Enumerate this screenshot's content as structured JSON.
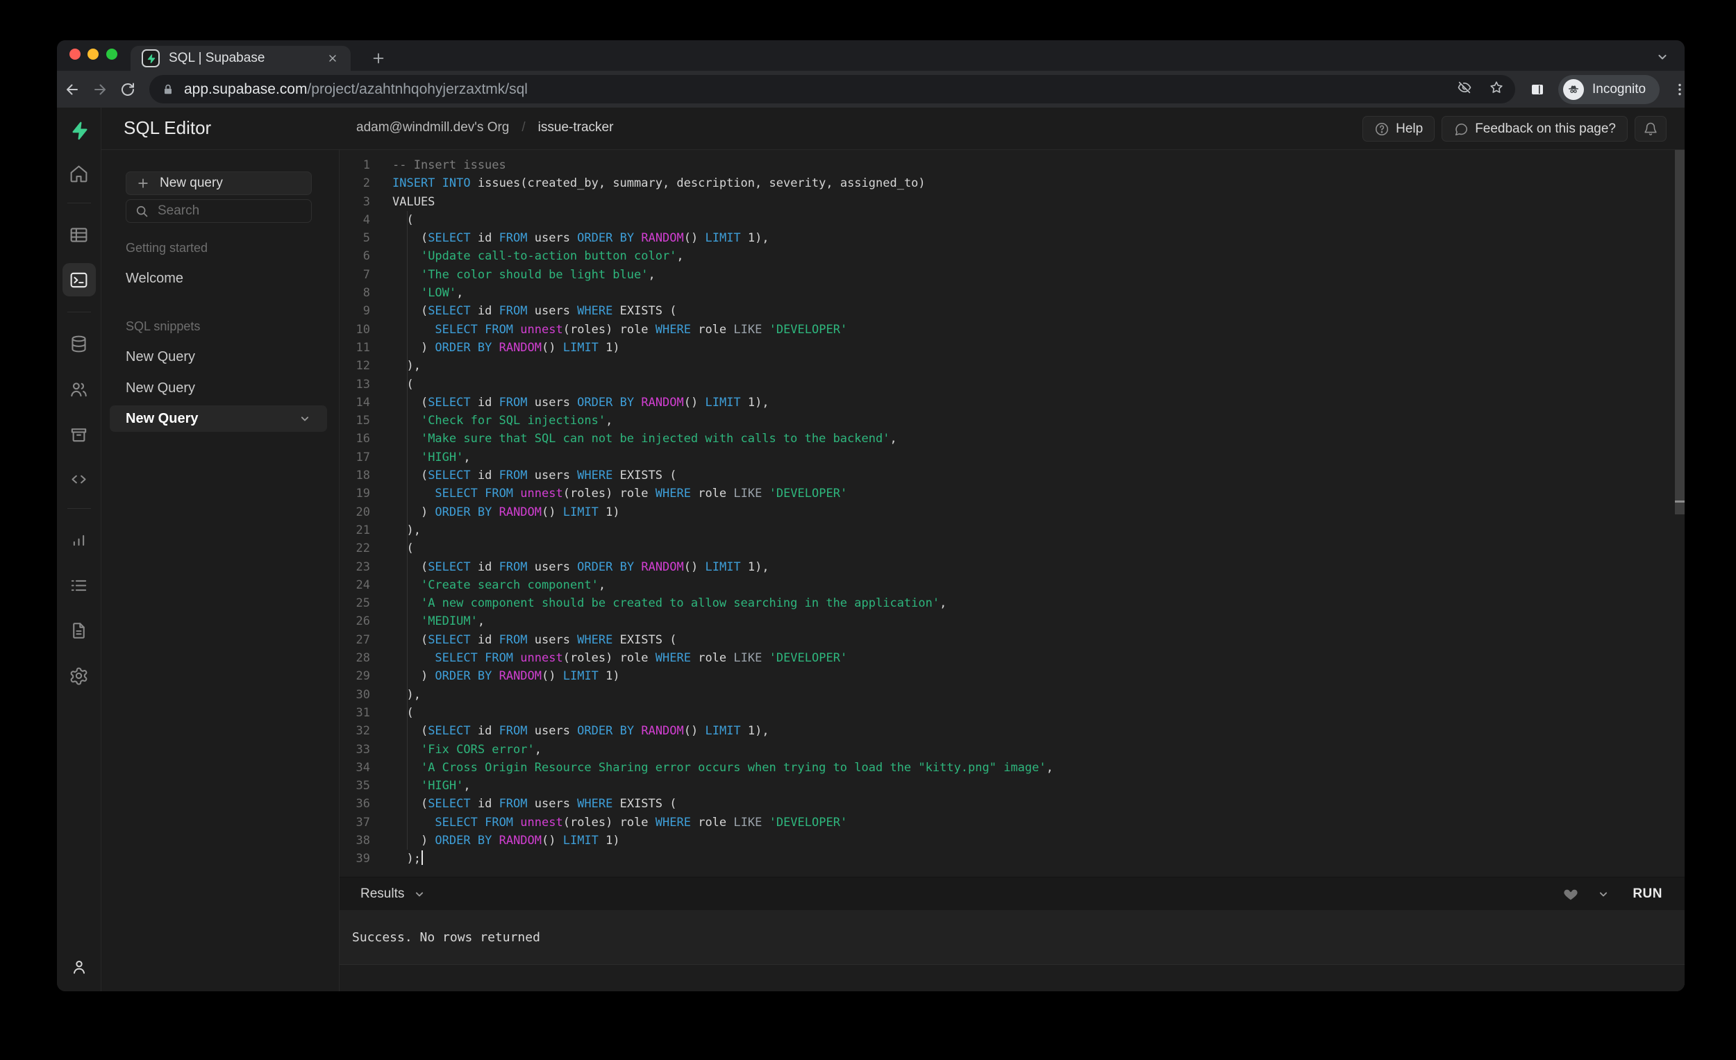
{
  "browser": {
    "tab_title": "SQL | Supabase",
    "url_host": "app.supabase.com",
    "url_path": "/project/azahtnhqohyjerzaxtmk/sql",
    "incognito_label": "Incognito"
  },
  "header": {
    "title": "SQL Editor",
    "breadcrumb": {
      "org": "adam@windmill.dev's Org",
      "separator": "/",
      "project": "issue-tracker"
    },
    "help_label": "Help",
    "feedback_label": "Feedback on this page?"
  },
  "rail": {
    "items": [
      {
        "name": "home"
      },
      {
        "name": "divider"
      },
      {
        "name": "table-editor"
      },
      {
        "name": "sql-editor",
        "active": true
      },
      {
        "name": "divider"
      },
      {
        "name": "database"
      },
      {
        "name": "auth"
      },
      {
        "name": "storage"
      },
      {
        "name": "edge-functions"
      },
      {
        "name": "divider"
      },
      {
        "name": "reports"
      },
      {
        "name": "logs"
      },
      {
        "name": "docs"
      },
      {
        "name": "settings"
      }
    ]
  },
  "sidebar": {
    "new_query_label": "New query",
    "search_placeholder": "Search",
    "sections": [
      {
        "label": "Getting started",
        "items": [
          {
            "label": "Welcome"
          }
        ]
      },
      {
        "label": "SQL snippets",
        "items": [
          {
            "label": "New Query"
          },
          {
            "label": "New Query"
          },
          {
            "label": "New Query",
            "active": true
          }
        ]
      }
    ]
  },
  "editor": {
    "cursor_line": 39,
    "lines": [
      [
        [
          "c",
          "-- Insert issues"
        ]
      ],
      [
        [
          "k",
          "INSERT"
        ],
        [
          "p",
          " "
        ],
        [
          "k",
          "INTO"
        ],
        [
          "p",
          " issues(created_by, summary, description, severity, assigned_to)"
        ]
      ],
      [
        [
          "p",
          "VALUES"
        ]
      ],
      [
        [
          "p",
          "  ("
        ]
      ],
      [
        [
          "p",
          "    ("
        ],
        [
          "k",
          "SELECT"
        ],
        [
          "p",
          " id "
        ],
        [
          "k",
          "FROM"
        ],
        [
          "p",
          " users "
        ],
        [
          "k",
          "ORDER"
        ],
        [
          "p",
          " "
        ],
        [
          "k",
          "BY"
        ],
        [
          "p",
          " "
        ],
        [
          "f",
          "RANDOM"
        ],
        [
          "p",
          "() "
        ],
        [
          "k",
          "LIMIT"
        ],
        [
          "p",
          " 1),"
        ]
      ],
      [
        [
          "p",
          "    "
        ],
        [
          "s",
          "'Update call-to-action button color'"
        ],
        [
          "p",
          ","
        ]
      ],
      [
        [
          "p",
          "    "
        ],
        [
          "s",
          "'The color should be light blue'"
        ],
        [
          "p",
          ","
        ]
      ],
      [
        [
          "p",
          "    "
        ],
        [
          "s",
          "'LOW'"
        ],
        [
          "p",
          ","
        ]
      ],
      [
        [
          "p",
          "    ("
        ],
        [
          "k",
          "SELECT"
        ],
        [
          "p",
          " id "
        ],
        [
          "k",
          "FROM"
        ],
        [
          "p",
          " users "
        ],
        [
          "k",
          "WHERE"
        ],
        [
          "p",
          " EXISTS ("
        ]
      ],
      [
        [
          "p",
          "      "
        ],
        [
          "k",
          "SELECT"
        ],
        [
          "p",
          " "
        ],
        [
          "k",
          "FROM"
        ],
        [
          "p",
          " "
        ],
        [
          "f",
          "unnest"
        ],
        [
          "p",
          "(roles) role "
        ],
        [
          "k",
          "WHERE"
        ],
        [
          "p",
          " role "
        ],
        [
          "o",
          "LIKE"
        ],
        [
          "p",
          " "
        ],
        [
          "s",
          "'DEVELOPER'"
        ]
      ],
      [
        [
          "p",
          "    ) "
        ],
        [
          "k",
          "ORDER"
        ],
        [
          "p",
          " "
        ],
        [
          "k",
          "BY"
        ],
        [
          "p",
          " "
        ],
        [
          "f",
          "RANDOM"
        ],
        [
          "p",
          "() "
        ],
        [
          "k",
          "LIMIT"
        ],
        [
          "p",
          " 1)"
        ]
      ],
      [
        [
          "p",
          "  ),"
        ]
      ],
      [
        [
          "p",
          "  ("
        ]
      ],
      [
        [
          "p",
          "    ("
        ],
        [
          "k",
          "SELECT"
        ],
        [
          "p",
          " id "
        ],
        [
          "k",
          "FROM"
        ],
        [
          "p",
          " users "
        ],
        [
          "k",
          "ORDER"
        ],
        [
          "p",
          " "
        ],
        [
          "k",
          "BY"
        ],
        [
          "p",
          " "
        ],
        [
          "f",
          "RANDOM"
        ],
        [
          "p",
          "() "
        ],
        [
          "k",
          "LIMIT"
        ],
        [
          "p",
          " 1),"
        ]
      ],
      [
        [
          "p",
          "    "
        ],
        [
          "s",
          "'Check for SQL injections'"
        ],
        [
          "p",
          ","
        ]
      ],
      [
        [
          "p",
          "    "
        ],
        [
          "s",
          "'Make sure that SQL can not be injected with calls to the backend'"
        ],
        [
          "p",
          ","
        ]
      ],
      [
        [
          "p",
          "    "
        ],
        [
          "s",
          "'HIGH'"
        ],
        [
          "p",
          ","
        ]
      ],
      [
        [
          "p",
          "    ("
        ],
        [
          "k",
          "SELECT"
        ],
        [
          "p",
          " id "
        ],
        [
          "k",
          "FROM"
        ],
        [
          "p",
          " users "
        ],
        [
          "k",
          "WHERE"
        ],
        [
          "p",
          " EXISTS ("
        ]
      ],
      [
        [
          "p",
          "      "
        ],
        [
          "k",
          "SELECT"
        ],
        [
          "p",
          " "
        ],
        [
          "k",
          "FROM"
        ],
        [
          "p",
          " "
        ],
        [
          "f",
          "unnest"
        ],
        [
          "p",
          "(roles) role "
        ],
        [
          "k",
          "WHERE"
        ],
        [
          "p",
          " role "
        ],
        [
          "o",
          "LIKE"
        ],
        [
          "p",
          " "
        ],
        [
          "s",
          "'DEVELOPER'"
        ]
      ],
      [
        [
          "p",
          "    ) "
        ],
        [
          "k",
          "ORDER"
        ],
        [
          "p",
          " "
        ],
        [
          "k",
          "BY"
        ],
        [
          "p",
          " "
        ],
        [
          "f",
          "RANDOM"
        ],
        [
          "p",
          "() "
        ],
        [
          "k",
          "LIMIT"
        ],
        [
          "p",
          " 1)"
        ]
      ],
      [
        [
          "p",
          "  ),"
        ]
      ],
      [
        [
          "p",
          "  ("
        ]
      ],
      [
        [
          "p",
          "    ("
        ],
        [
          "k",
          "SELECT"
        ],
        [
          "p",
          " id "
        ],
        [
          "k",
          "FROM"
        ],
        [
          "p",
          " users "
        ],
        [
          "k",
          "ORDER"
        ],
        [
          "p",
          " "
        ],
        [
          "k",
          "BY"
        ],
        [
          "p",
          " "
        ],
        [
          "f",
          "RANDOM"
        ],
        [
          "p",
          "() "
        ],
        [
          "k",
          "LIMIT"
        ],
        [
          "p",
          " 1),"
        ]
      ],
      [
        [
          "p",
          "    "
        ],
        [
          "s",
          "'Create search component'"
        ],
        [
          "p",
          ","
        ]
      ],
      [
        [
          "p",
          "    "
        ],
        [
          "s",
          "'A new component should be created to allow searching in the application'"
        ],
        [
          "p",
          ","
        ]
      ],
      [
        [
          "p",
          "    "
        ],
        [
          "s",
          "'MEDIUM'"
        ],
        [
          "p",
          ","
        ]
      ],
      [
        [
          "p",
          "    ("
        ],
        [
          "k",
          "SELECT"
        ],
        [
          "p",
          " id "
        ],
        [
          "k",
          "FROM"
        ],
        [
          "p",
          " users "
        ],
        [
          "k",
          "WHERE"
        ],
        [
          "p",
          " EXISTS ("
        ]
      ],
      [
        [
          "p",
          "      "
        ],
        [
          "k",
          "SELECT"
        ],
        [
          "p",
          " "
        ],
        [
          "k",
          "FROM"
        ],
        [
          "p",
          " "
        ],
        [
          "f",
          "unnest"
        ],
        [
          "p",
          "(roles) role "
        ],
        [
          "k",
          "WHERE"
        ],
        [
          "p",
          " role "
        ],
        [
          "o",
          "LIKE"
        ],
        [
          "p",
          " "
        ],
        [
          "s",
          "'DEVELOPER'"
        ]
      ],
      [
        [
          "p",
          "    ) "
        ],
        [
          "k",
          "ORDER"
        ],
        [
          "p",
          " "
        ],
        [
          "k",
          "BY"
        ],
        [
          "p",
          " "
        ],
        [
          "f",
          "RANDOM"
        ],
        [
          "p",
          "() "
        ],
        [
          "k",
          "LIMIT"
        ],
        [
          "p",
          " 1)"
        ]
      ],
      [
        [
          "p",
          "  ),"
        ]
      ],
      [
        [
          "p",
          "  ("
        ]
      ],
      [
        [
          "p",
          "    ("
        ],
        [
          "k",
          "SELECT"
        ],
        [
          "p",
          " id "
        ],
        [
          "k",
          "FROM"
        ],
        [
          "p",
          " users "
        ],
        [
          "k",
          "ORDER"
        ],
        [
          "p",
          " "
        ],
        [
          "k",
          "BY"
        ],
        [
          "p",
          " "
        ],
        [
          "f",
          "RANDOM"
        ],
        [
          "p",
          "() "
        ],
        [
          "k",
          "LIMIT"
        ],
        [
          "p",
          " 1),"
        ]
      ],
      [
        [
          "p",
          "    "
        ],
        [
          "s",
          "'Fix CORS error'"
        ],
        [
          "p",
          ","
        ]
      ],
      [
        [
          "p",
          "    "
        ],
        [
          "s",
          "'A Cross Origin Resource Sharing error occurs when trying to load the \"kitty.png\" image'"
        ],
        [
          "p",
          ","
        ]
      ],
      [
        [
          "p",
          "    "
        ],
        [
          "s",
          "'HIGH'"
        ],
        [
          "p",
          ","
        ]
      ],
      [
        [
          "p",
          "    ("
        ],
        [
          "k",
          "SELECT"
        ],
        [
          "p",
          " id "
        ],
        [
          "k",
          "FROM"
        ],
        [
          "p",
          " users "
        ],
        [
          "k",
          "WHERE"
        ],
        [
          "p",
          " EXISTS ("
        ]
      ],
      [
        [
          "p",
          "      "
        ],
        [
          "k",
          "SELECT"
        ],
        [
          "p",
          " "
        ],
        [
          "k",
          "FROM"
        ],
        [
          "p",
          " "
        ],
        [
          "f",
          "unnest"
        ],
        [
          "p",
          "(roles) role "
        ],
        [
          "k",
          "WHERE"
        ],
        [
          "p",
          " role "
        ],
        [
          "o",
          "LIKE"
        ],
        [
          "p",
          " "
        ],
        [
          "s",
          "'DEVELOPER'"
        ]
      ],
      [
        [
          "p",
          "    ) "
        ],
        [
          "k",
          "ORDER"
        ],
        [
          "p",
          " "
        ],
        [
          "k",
          "BY"
        ],
        [
          "p",
          " "
        ],
        [
          "f",
          "RANDOM"
        ],
        [
          "p",
          "() "
        ],
        [
          "k",
          "LIMIT"
        ],
        [
          "p",
          " 1)"
        ]
      ],
      [
        [
          "p",
          "  );"
        ]
      ]
    ]
  },
  "results": {
    "label": "Results",
    "success_message": "Success. No rows returned",
    "run_label": "RUN"
  },
  "colors": {
    "accent_green": "#3ECF8E",
    "keyword": "#3E9FD9",
    "string": "#2EB67D",
    "function": "#D23FD2",
    "comment": "#7D7D7D",
    "plain": "#D6D6D6",
    "operator": "#9AA2AA",
    "traffic_red": "#FF5F57",
    "traffic_yellow": "#FEBC2E",
    "traffic_green": "#29C83F"
  }
}
